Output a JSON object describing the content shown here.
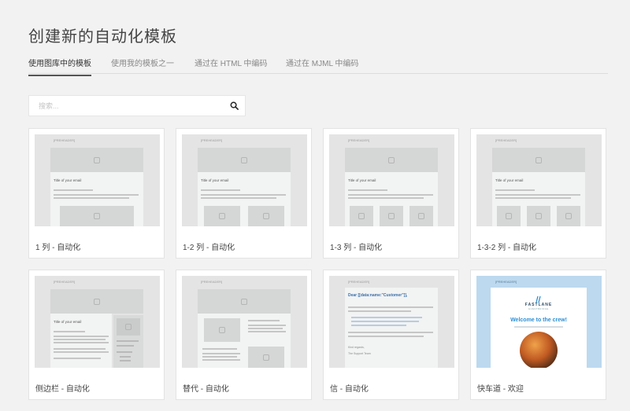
{
  "page_title": "创建新的自动化模板",
  "tabs": [
    {
      "label": "使用图库中的模板",
      "active": true
    },
    {
      "label": "使用我的模板之一",
      "active": false
    },
    {
      "label": "通过在 HTML 中编码",
      "active": false
    },
    {
      "label": "通过在 MJML 中编码",
      "active": false
    }
  ],
  "search": {
    "placeholder": "搜索...",
    "icon": "search-icon"
  },
  "templates": [
    {
      "label": "1 列 - 自动化"
    },
    {
      "label": "1-2 列 - 自动化"
    },
    {
      "label": "1-3 列 - 自动化"
    },
    {
      "label": "1-3-2 列 - 自动化"
    },
    {
      "label": "侧边栏 - 自动化"
    },
    {
      "label": "替代 - 自动化"
    },
    {
      "label": "信 - 自动化"
    },
    {
      "label": "快车道 - 欢迎"
    }
  ],
  "thumb_text": {
    "preheader": "[PREHEADER]",
    "title": "Title of your email",
    "letter_greeting": "Dear [[data:name:\"Customer\"]],",
    "letter_regards": "Kind regards,",
    "letter_sign": "The Support Team",
    "fastlane_brand": "FASTLANE",
    "fastlane_sub": "EVENTBRIDGE",
    "fastlane_welcome": "Welcome to the crew!"
  },
  "colors": {
    "fastlane_accent": "#2d8fd6",
    "fastlane_bg": "#bcd9ef"
  }
}
